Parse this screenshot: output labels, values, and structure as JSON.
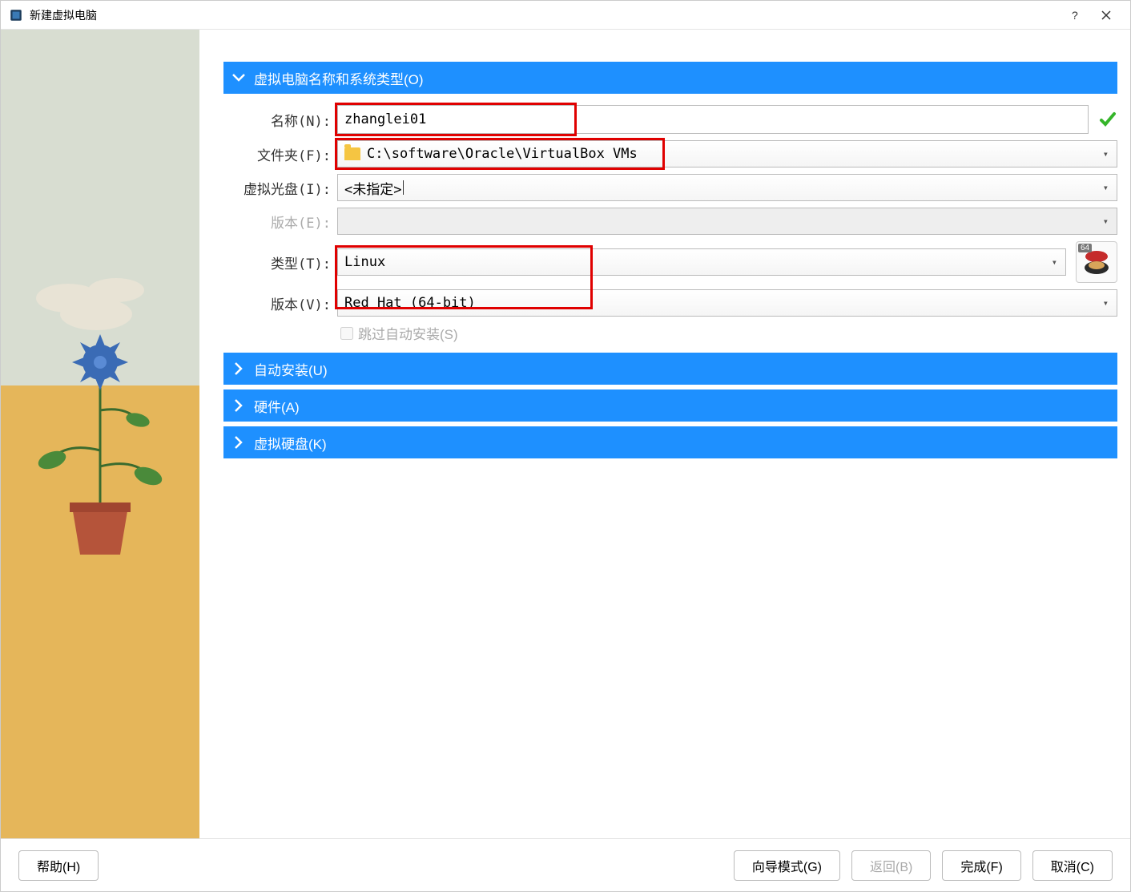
{
  "titlebar": {
    "title": "新建虚拟电脑"
  },
  "sections": {
    "nameAndOS": "虚拟电脑名称和系统类型(O)",
    "autoInstall": "自动安装(U)",
    "hardware": "硬件(A)",
    "virtualDisk": "虚拟硬盘(K)"
  },
  "form": {
    "name_label": "名称(N):",
    "name_value": "zhanglei01",
    "folder_label": "文件夹(F):",
    "folder_value": "C:\\software\\Oracle\\VirtualBox VMs",
    "iso_label": "虚拟光盘(I):",
    "iso_value": "<未指定>",
    "edition_label": "版本(E):",
    "type_label": "类型(T):",
    "type_value": "Linux",
    "version_label": "版本(V):",
    "version_value": "Red Hat (64-bit)",
    "skip_label": "跳过自动安装(S)",
    "os_bits": "64"
  },
  "buttons": {
    "help": "帮助(H)",
    "wizard": "向导模式(G)",
    "back": "返回(B)",
    "finish": "完成(F)",
    "cancel": "取消(C)"
  }
}
